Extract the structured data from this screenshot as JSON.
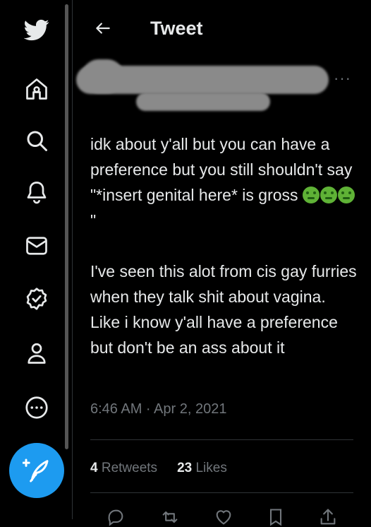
{
  "header": {
    "title": "Tweet"
  },
  "tweet": {
    "paragraph1": "idk about y'all but you can have a preference but you still shouldn't say \"*insert genital here* is gross",
    "paragraph1_tail": "\"",
    "emoji": "nauseated-face",
    "paragraph2": "I've seen this alot from cis gay furries when they talk shit about vagina. Like i know y'all have a preference but don't be an ass about it",
    "timestamp": "6:46 AM · Apr 2, 2021",
    "retweets_count": "4",
    "retweets_label": "Retweets",
    "likes_count": "23",
    "likes_label": "Likes"
  },
  "colors": {
    "accent": "#1d9bf0",
    "background": "#000000",
    "text": "#e7e9ea",
    "muted": "#71767b"
  },
  "sidebar_icons": [
    "twitter-logo",
    "home-icon",
    "search-icon",
    "bell-icon",
    "mail-icon",
    "verified-icon",
    "profile-icon",
    "more-circle-icon",
    "compose-icon"
  ]
}
